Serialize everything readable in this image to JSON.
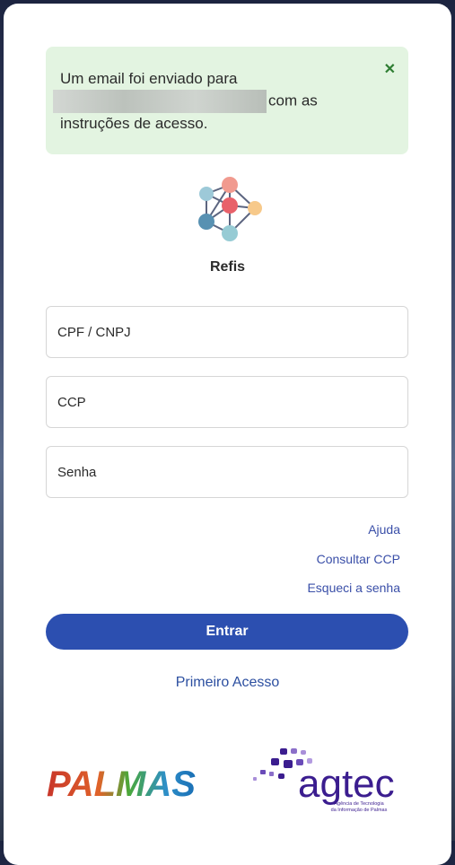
{
  "alert": {
    "line1": "Um email foi enviado para",
    "line2_suffix": "com as",
    "line3": "instruções de acesso.",
    "close_icon": "close-icon"
  },
  "app": {
    "name": "Refis",
    "logo_icon": "network-nodes-icon"
  },
  "form": {
    "cpf_placeholder": "CPF / CNPJ",
    "ccp_placeholder": "CCP",
    "password_placeholder": "Senha"
  },
  "links": {
    "help": "Ajuda",
    "consult_ccp": "Consultar CCP",
    "forgot_password": "Esqueci a senha"
  },
  "buttons": {
    "enter": "Entrar",
    "first_access": "Primeiro Acesso"
  },
  "footer": {
    "palmas_logo": "PALMAS",
    "agtec_logo": "agtec",
    "agtec_subtitle_1": "Agência de Tecnologia",
    "agtec_subtitle_2": "da Informação de Palmas"
  },
  "colors": {
    "primary": "#2c4fb0",
    "alert_bg": "#e3f4e1",
    "link": "#3a4fa8",
    "agtec_purple": "#3b1d8f"
  }
}
